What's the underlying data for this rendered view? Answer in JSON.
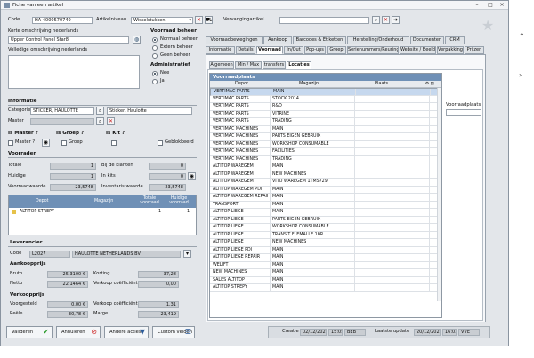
{
  "window": {
    "title": "Fiche van een artikel"
  },
  "top": {
    "code_label": "Code",
    "code_value": "HA-4000570740",
    "niveau_label": "Artikelniveau",
    "niveau_value": "Wisselstukken",
    "vervanging_label": "Vervangingartikel",
    "vervanging_value": ""
  },
  "left": {
    "korte_label": "Korte omschrijving nederlands",
    "korte_value": "Upper Control Panel Star8",
    "volledige_label": "Volledige omschrijving nederlands",
    "volledige_value": "",
    "voorraadbeheer": {
      "title": "Voorraad beheer",
      "options": [
        "Normaal beheer",
        "Extern beheer",
        "Geen beheer"
      ]
    },
    "administratief": {
      "title": "Administratief",
      "options": [
        "Nee",
        "Ja"
      ]
    },
    "informatie": {
      "title": "Informatie",
      "categorie_label": "Categorie",
      "categorie_value": "STICKER, HAULOTTE",
      "categorie_value2": "Sticker, Haulotte",
      "master_label": "Master"
    },
    "ismaster": {
      "title": "Is Master ?",
      "label": "Master ?"
    },
    "isgroep": {
      "title": "Is Groep ?",
      "label": "Groep"
    },
    "iskit": {
      "title": "Is Kit ?",
      "label": "Geblokkeerd"
    },
    "voorraden": {
      "title": "Voorraden",
      "totale_label": "Totale",
      "totale_value": "1",
      "huidige_label": "Huidige",
      "huidige_value": "1",
      "waarde_label": "Voorraadwaarde",
      "waarde_value": "23,5748",
      "klanten_label": "Bij de klanten",
      "klanten_value": "0",
      "inkits_label": "In kits",
      "inkits_value": "0",
      "inventaris_label": "Inventaris waarde",
      "inventaris_value": "23,5748"
    },
    "stockgrid": {
      "columns": [
        "Depot",
        "Magazijn",
        "Totale voorraad",
        "Huidige voorraad"
      ],
      "rows": [
        {
          "depot": "ALTITOP STREPY",
          "magazijn": "",
          "totale": "1",
          "huidige": "1"
        }
      ]
    },
    "leverancier": {
      "title": "Leverancier",
      "code_label": "Code",
      "code_value": "L2027",
      "name_value": "HAULOTTE NETHERLANDS BV"
    },
    "aankoop": {
      "title": "Aankoopprijs",
      "bruto_label": "Bruto",
      "bruto_value": "25,3100 €",
      "korting_label": "Korting",
      "korting_value": "37,28",
      "netto_label": "Netto",
      "netto_value": "22,1464 €",
      "coef_label": "Verkoop coëfficiënt",
      "coef_value": "0,00"
    },
    "verkoop": {
      "title": "Verkoopprijs",
      "voorgesteld_label": "Voorgesteld",
      "voorgesteld_value": "0,00 €",
      "coef_label": "Verkoop coëfficiënt",
      "coef_value": "1,31",
      "reele_label": "Reële",
      "reele_value": "30,78 €",
      "marge_label": "Marge",
      "marge_value": "23,419"
    }
  },
  "tabs_row1": [
    "Voorraadbewegingen",
    "Aankoop",
    "Barcodes & Etiketten",
    "Herstelling/Onderhoud",
    "Documenten",
    "CRM"
  ],
  "tabs_row2": [
    "Informatie",
    "Details",
    "Voorraad",
    "In/Out",
    "Pop-ups",
    "Groep",
    "Serienummers/Reuringen",
    "Website / Beeld",
    "Verpakking",
    "Prijzen"
  ],
  "subtabs": [
    "Algemeen",
    "Min / Max",
    "transfers",
    "Locaties"
  ],
  "vp": {
    "title": "Voorraadplaats",
    "columns": [
      "Depot",
      "Magazijn",
      "Plaats"
    ],
    "rows": [
      {
        "depot": "VERTIMAC PARTS",
        "magazijn": "MAIN"
      },
      {
        "depot": "VERTIMAC PARTS",
        "magazijn": "STOCK 2014"
      },
      {
        "depot": "VERTIMAC PARTS",
        "magazijn": "R&D"
      },
      {
        "depot": "VERTIMAC PARTS",
        "magazijn": "VITRINE"
      },
      {
        "depot": "VERTIMAC PARTS",
        "magazijn": "TRADING"
      },
      {
        "depot": "VERTIMAC MACHINES",
        "magazijn": "MAIN"
      },
      {
        "depot": "VERTIMAC MACHINES",
        "magazijn": "PARTS EIGEN GEBRUIK"
      },
      {
        "depot": "VERTIMAC MACHINES",
        "magazijn": "WORKSHOP CONSUMABLE"
      },
      {
        "depot": "VERTIMAC MACHINES",
        "magazijn": "FACILITIES"
      },
      {
        "depot": "VERTIMAC MACHINES",
        "magazijn": "TRADING"
      },
      {
        "depot": "ALTITOP WAREGEM",
        "magazijn": "MAIN"
      },
      {
        "depot": "ALTITOP WAREGEM",
        "magazijn": "NEW MACHINES"
      },
      {
        "depot": "ALTITOP WAREGEM",
        "magazijn": "VITO WAREGEM 1TMS729"
      },
      {
        "depot": "ALTITOP WAREGEM PDI",
        "magazijn": "MAIN"
      },
      {
        "depot": "ALTITOP WAREGEM REPAIR",
        "magazijn": "MAIN"
      },
      {
        "depot": "TRANSPORT",
        "magazijn": "MAIN"
      },
      {
        "depot": "ALTITOP LIEGE",
        "magazijn": "MAIN"
      },
      {
        "depot": "ALTITOP LIEGE",
        "magazijn": "PARTS EIGEN GEBRUIK"
      },
      {
        "depot": "ALTITOP LIEGE",
        "magazijn": "WORKSHOP CONSUMABLE"
      },
      {
        "depot": "ALTITOP LIEGE",
        "magazijn": "TRANSIT FLEMALLE 1KR"
      },
      {
        "depot": "ALTITOP LIEGE",
        "magazijn": "NEW MACHINES"
      },
      {
        "depot": "ALTITOP LIEGE PDI",
        "magazijn": "MAIN"
      },
      {
        "depot": "ALTITOP LIEGE REPAIR",
        "magazijn": "MAIN"
      },
      {
        "depot": "WELIFT",
        "magazijn": "MAIN"
      },
      {
        "depot": "NEW MACHINES",
        "magazijn": "MAIN"
      },
      {
        "depot": "SALES ALTITOP",
        "magazijn": "MAIN"
      },
      {
        "depot": "ALTITOP STREPY",
        "magazijn": "MAIN"
      }
    ]
  },
  "vp_label": "Voorraadplaats",
  "buttons": {
    "valideren": "Valideren",
    "annuleren": "Annuleren",
    "andere": "Andere acties",
    "custom": "Custom velden"
  },
  "status": {
    "creatie_label": "Creatie",
    "creatie_date": "02/12/2022",
    "creatie_time": "15:05",
    "creatie_user": "BEB",
    "update_label": "Laatste update",
    "update_date": "20/12/2022",
    "update_time": "16:03",
    "update_user": "VVE"
  },
  "colors": {
    "grid_header": "#6f90b6",
    "window_bg": "#e3e6ea"
  }
}
